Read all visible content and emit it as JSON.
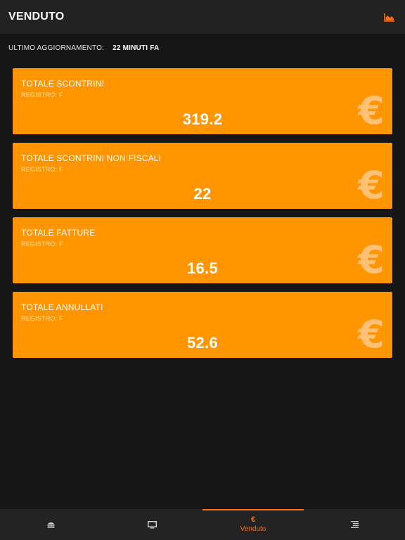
{
  "header": {
    "title": "VENDUTO",
    "chart_icon": "area-chart-icon"
  },
  "update": {
    "label": "ULTIMO AGGIORNAMENTO:",
    "value": "22 MINUTI FA"
  },
  "cards": [
    {
      "title": "TOTALE SCONTRINI",
      "subtitle": "REGISTRO: F",
      "value": "319.2",
      "icon": "euro-icon"
    },
    {
      "title": "TOTALE SCONTRINI NON FISCALI",
      "subtitle": "REGISTRO: F",
      "value": "22",
      "icon": "euro-icon"
    },
    {
      "title": "TOTALE FATTURE",
      "subtitle": "REGISTRO: F",
      "value": "16.5",
      "icon": "euro-icon"
    },
    {
      "title": "TOTALE ANNULLATI",
      "subtitle": "REGISTRO: F",
      "value": "52.6",
      "icon": "euro-icon"
    }
  ],
  "tabbar": {
    "tabs": [
      {
        "icon": "burger-icon",
        "label": ""
      },
      {
        "icon": "monitor-icon",
        "label": ""
      },
      {
        "icon": "euro-icon",
        "label": "Venduto",
        "active": true
      },
      {
        "icon": "list-icon",
        "label": ""
      }
    ],
    "active_glyph": "€"
  },
  "colors": {
    "accent": "#ff6a13",
    "card": "#ff9500",
    "background": "#161616",
    "header": "#222222"
  }
}
